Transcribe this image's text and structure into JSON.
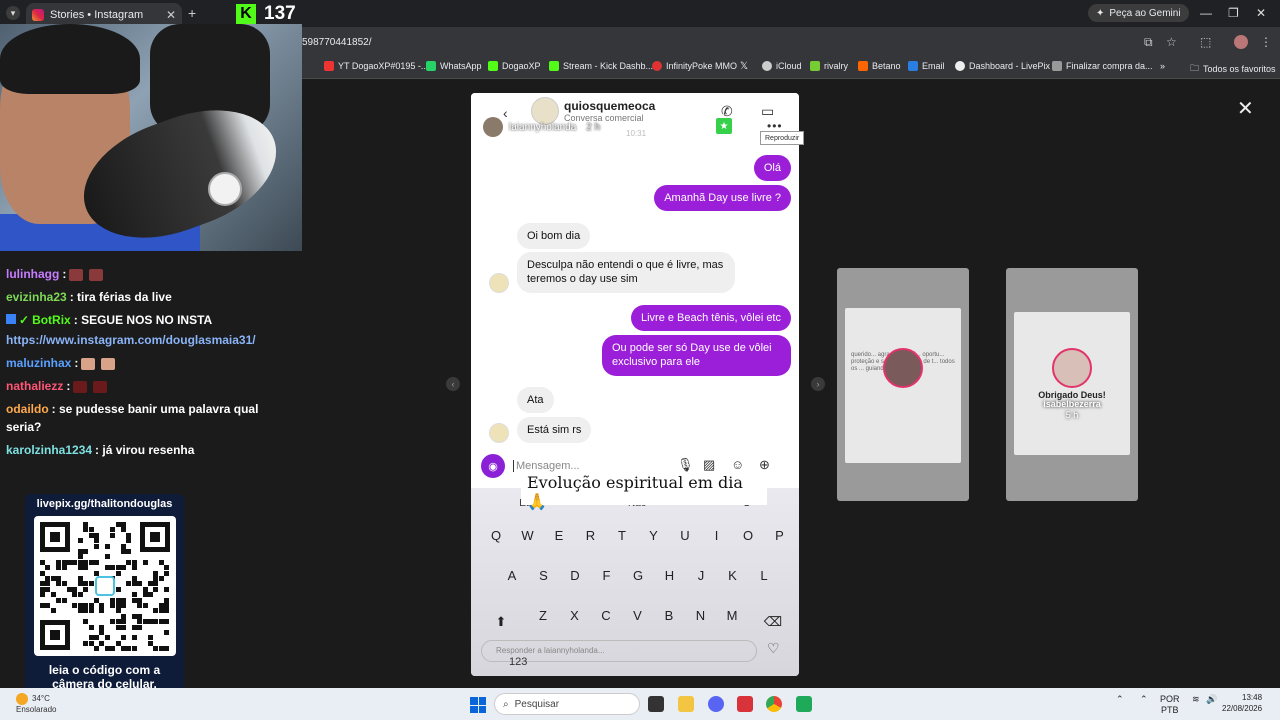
{
  "browser": {
    "tab_title": "Stories • Instagram",
    "url": "598770441852/",
    "gemini_label": "Peça ao Gemini",
    "bookmarks": [
      {
        "label": "YT DogaoXP#0195 -...",
        "color": "#e33"
      },
      {
        "label": "WhatsApp",
        "color": "#25d366"
      },
      {
        "label": "DogaoXP",
        "color": "#53fc18"
      },
      {
        "label": "Stream - Kick Dashb...",
        "color": "#53fc18"
      },
      {
        "label": "InfinityPoke MMO",
        "color": "#d33"
      },
      {
        "label": "",
        "color": "#222"
      },
      {
        "label": "iCloud",
        "color": "#ccc"
      },
      {
        "label": "rivalry",
        "color": "#7c3"
      },
      {
        "label": "Betano",
        "color": "#f60"
      },
      {
        "label": "Email",
        "color": "#2a7de1"
      },
      {
        "label": "Dashboard - LivePix",
        "color": "#eee"
      },
      {
        "label": "Finalizar compra da...",
        "color": "#999"
      }
    ],
    "all_favorites": "Todos os favoritos"
  },
  "stream": {
    "viewer_count": "137",
    "chat": [
      {
        "user": "lulinhagg",
        "user_color": "#c77dff",
        "msg": ":",
        "emotes": 2
      },
      {
        "user": "evizinha23",
        "user_color": "#7ed957",
        "msg": ": tira férias da live",
        "emotes": 0
      },
      {
        "user": "BotRix",
        "user_color": "#53fc18",
        "msg": ": SEGUE NOS NO INSTA",
        "emotes": 0
      },
      {
        "user": "",
        "user_color": "#8ab4f8",
        "msg": "https://www.instagram.com/douglasmaia31/",
        "emotes": 0
      },
      {
        "user": "maluzinhax",
        "user_color": "#5aa0ff",
        "msg": ":",
        "emotes": 2
      },
      {
        "user": "nathaliezz",
        "user_color": "#ff5577",
        "msg": ":",
        "emotes": 2
      },
      {
        "user": "odaildo",
        "user_color": "#ffa94d",
        "msg": ": se pudesse banir uma palavra qual",
        "emotes": 0
      },
      {
        "user": "",
        "user_color": "#fff",
        "msg": "seria?",
        "emotes": 0
      },
      {
        "user": "karolzinha1234",
        "user_color": "#7ee0e0",
        "msg": ": já virou resenha",
        "emotes": 0
      }
    ],
    "qr_title": "livepix.gg/thalitondouglas",
    "qr_caption_1": "leia o código com a",
    "qr_caption_2": "câmera do celular."
  },
  "dm": {
    "contact_name": "quiosquemeoca",
    "contact_sub": "Conversa comercial",
    "story_user": "laiannyholanda",
    "story_time": "2 h",
    "time_stamp": "10:31",
    "tooltip": "Reproduzir",
    "messages": [
      {
        "side": "out",
        "text": "Olá"
      },
      {
        "side": "out",
        "text": "Amanhã Day use livre ?"
      },
      {
        "side": "in",
        "text": "Oi bom dia"
      },
      {
        "side": "in",
        "text": "Desculpa não entendi o que é livre, mas teremos o day use sim"
      },
      {
        "side": "out",
        "text": "Livre e Beach tênis, vôlei etc"
      },
      {
        "side": "out",
        "text": "Ou pode ser só Day use de vôlei exclusivo para ele"
      },
      {
        "side": "in",
        "text": "Ata"
      },
      {
        "side": "in",
        "text": "Está sim rs"
      }
    ],
    "composer_placeholder": "Mensagem...",
    "suggestion": "Evolução espiritual em dia 🙏",
    "word_suggestions": [
      "Eu",
      "Não",
      "O"
    ],
    "keyboard_rows": [
      [
        "Q",
        "W",
        "E",
        "R",
        "T",
        "Y",
        "U",
        "I",
        "O",
        "P"
      ],
      [
        "A",
        "S",
        "D",
        "F",
        "G",
        "H",
        "J",
        "K",
        "L"
      ],
      [
        "Z",
        "X",
        "C",
        "V",
        "B",
        "N",
        "M"
      ]
    ],
    "reply_placeholder": "Responder a laiannyholanda...",
    "key_123": "123"
  },
  "stories": [
    {
      "name": "",
      "time": "",
      "text": "querido... agrad... de vid... oportu... proteção e saúde. Me livra de t... todos os ... guiando."
    },
    {
      "name": "isabelbezerra",
      "time": "5 h",
      "text": "Obrigado Deus!"
    }
  ],
  "taskbar": {
    "weather_temp": "34°C",
    "weather_desc": "Ensolarado",
    "search": "Pesquisar",
    "lang_1": "POR",
    "lang_2": "PTB",
    "time": "13:48",
    "date": "22/08/2026"
  }
}
